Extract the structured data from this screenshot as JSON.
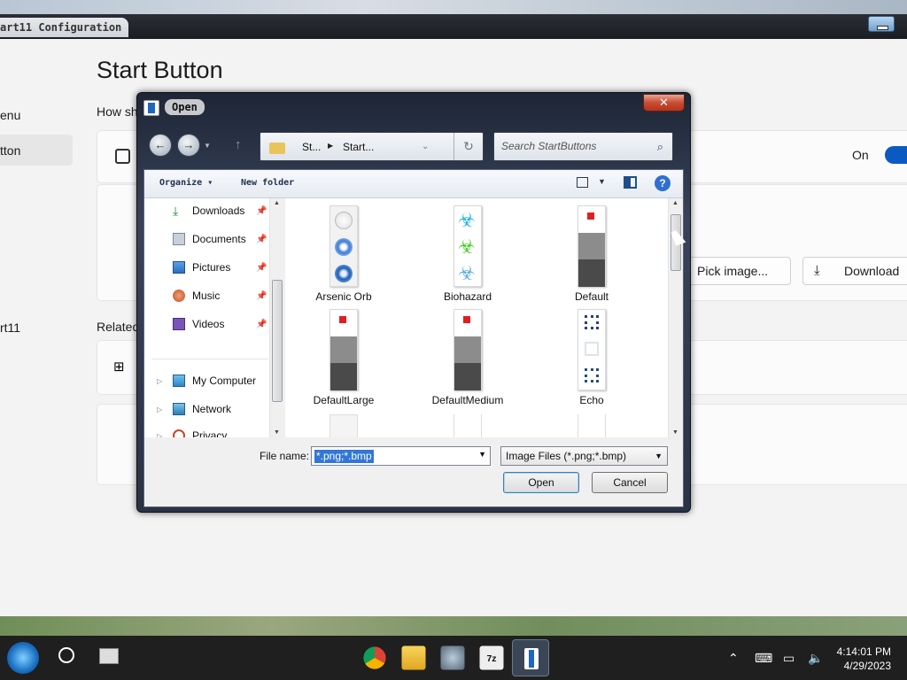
{
  "app": {
    "title": "art11 Configuration",
    "page_title": "Start Button",
    "nav": [
      "enu",
      "tton",
      "rt11"
    ],
    "section_how": "How sh",
    "section_related": "Related",
    "toggle_label": "On",
    "pick_image_label": "Pick image...",
    "download_label": "Download"
  },
  "dialog": {
    "title": "Open",
    "close_glyph": "✕",
    "breadcrumb": [
      "St...",
      "Start..."
    ],
    "search_placeholder": "Search StartButtons",
    "toolbar": {
      "organize": "Organize",
      "new_folder": "New folder",
      "help": "?"
    },
    "nav_items": [
      {
        "label": "Downloads",
        "icon": "download-icon",
        "pinned": true
      },
      {
        "label": "Documents",
        "icon": "documents-icon",
        "pinned": true
      },
      {
        "label": "Pictures",
        "icon": "pictures-icon",
        "pinned": true
      },
      {
        "label": "Music",
        "icon": "music-icon",
        "pinned": true
      },
      {
        "label": "Videos",
        "icon": "videos-icon",
        "pinned": true
      },
      {
        "label": "My Computer",
        "icon": "computer-icon",
        "pinned": false
      },
      {
        "label": "Network",
        "icon": "network-icon",
        "pinned": false
      },
      {
        "label": "Privacy",
        "icon": "privacy-icon",
        "pinned": false
      }
    ],
    "files": [
      {
        "name": "Arsenic Orb"
      },
      {
        "name": "Biohazard"
      },
      {
        "name": "Default"
      },
      {
        "name": "DefaultLarge"
      },
      {
        "name": "DefaultMedium"
      },
      {
        "name": "Echo"
      }
    ],
    "file_name_label": "File name:",
    "file_name_value": "*.png;*.bmp",
    "file_type_value": "Image Files (*.png;*.bmp)",
    "open_label": "Open",
    "cancel_label": "Cancel"
  },
  "taskbar": {
    "time": "4:14:01 PM",
    "date": "4/29/2023"
  },
  "colors": {
    "accent": "#0a5ac2",
    "selection": "#3277d8"
  }
}
